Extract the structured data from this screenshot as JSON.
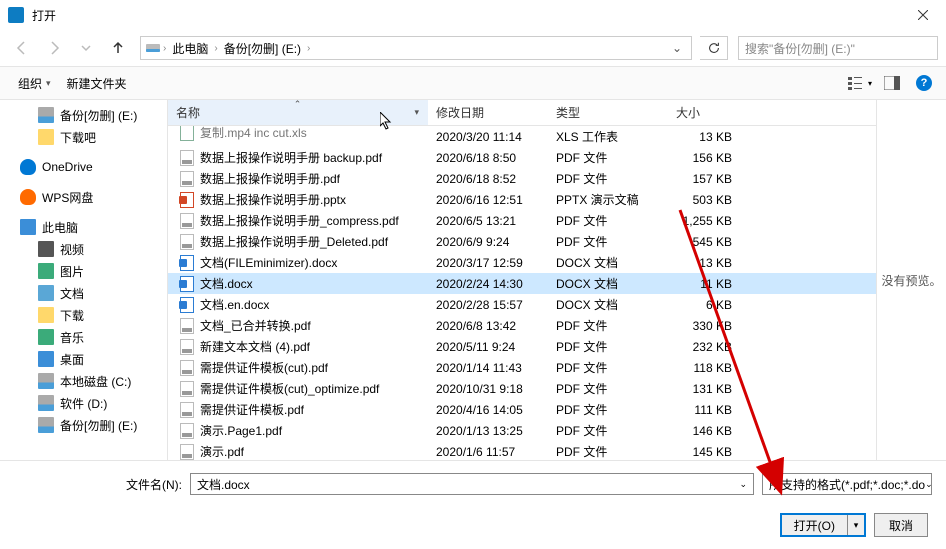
{
  "title": "打开",
  "breadcrumb": {
    "pc": "此电脑",
    "drive": "备份[勿删] (E:)"
  },
  "search_placeholder": "搜索\"备份[勿删] (E:)\"",
  "toolbar": {
    "organize": "组织",
    "newfolder": "新建文件夹"
  },
  "sidebar": [
    {
      "label": "备份[勿删] (E:)",
      "type": "drive",
      "indent": true
    },
    {
      "label": "下载吧",
      "type": "folder-dl",
      "indent": true
    },
    {
      "sep": true
    },
    {
      "label": "OneDrive",
      "type": "onedrive"
    },
    {
      "sep": true
    },
    {
      "label": "WPS网盘",
      "type": "wps"
    },
    {
      "sep": true
    },
    {
      "label": "此电脑",
      "type": "pc"
    },
    {
      "label": "视频",
      "type": "video",
      "indent": true
    },
    {
      "label": "图片",
      "type": "pictures",
      "indent": true
    },
    {
      "label": "文档",
      "type": "docs",
      "indent": true
    },
    {
      "label": "下载",
      "type": "folder-dl",
      "indent": true
    },
    {
      "label": "音乐",
      "type": "music",
      "indent": true
    },
    {
      "label": "桌面",
      "type": "desktop",
      "indent": true
    },
    {
      "label": "本地磁盘 (C:)",
      "type": "drive",
      "indent": true
    },
    {
      "label": "软件 (D:)",
      "type": "drive",
      "indent": true
    },
    {
      "label": "备份[勿删] (E:)",
      "type": "drive",
      "indent": true
    }
  ],
  "columns": {
    "name": "名称",
    "date": "修改日期",
    "type": "类型",
    "size": "大小"
  },
  "files": [
    {
      "name": "复制.mp4 inc cut.xls",
      "date": "2020/3/20 11:14",
      "type": "XLS 工作表",
      "size": "13 KB",
      "icon": "xls",
      "cut": true
    },
    {
      "name": "数据上报操作说明手册 backup.pdf",
      "date": "2020/6/18 8:50",
      "type": "PDF 文件",
      "size": "156 KB",
      "icon": "pdf"
    },
    {
      "name": "数据上报操作说明手册.pdf",
      "date": "2020/6/18 8:52",
      "type": "PDF 文件",
      "size": "157 KB",
      "icon": "pdf"
    },
    {
      "name": "数据上报操作说明手册.pptx",
      "date": "2020/6/16 12:51",
      "type": "PPTX 演示文稿",
      "size": "503 KB",
      "icon": "pptx"
    },
    {
      "name": "数据上报操作说明手册_compress.pdf",
      "date": "2020/6/5 13:21",
      "type": "PDF 文件",
      "size": "1,255 KB",
      "icon": "pdf"
    },
    {
      "name": "数据上报操作说明手册_Deleted.pdf",
      "date": "2020/6/9 9:24",
      "type": "PDF 文件",
      "size": "545 KB",
      "icon": "pdf"
    },
    {
      "name": "文档(FILEminimizer).docx",
      "date": "2020/3/17 12:59",
      "type": "DOCX 文档",
      "size": "13 KB",
      "icon": "docx"
    },
    {
      "name": "文档.docx",
      "date": "2020/2/24 14:30",
      "type": "DOCX 文档",
      "size": "11 KB",
      "icon": "docx",
      "selected": true
    },
    {
      "name": "文档.en.docx",
      "date": "2020/2/28 15:57",
      "type": "DOCX 文档",
      "size": "6 KB",
      "icon": "docx"
    },
    {
      "name": "文档_已合并转换.pdf",
      "date": "2020/6/8 13:42",
      "type": "PDF 文件",
      "size": "330 KB",
      "icon": "pdf"
    },
    {
      "name": "新建文本文档 (4).pdf",
      "date": "2020/5/11 9:24",
      "type": "PDF 文件",
      "size": "232 KB",
      "icon": "pdf"
    },
    {
      "name": "需提供证件模板(cut).pdf",
      "date": "2020/1/14 11:43",
      "type": "PDF 文件",
      "size": "118 KB",
      "icon": "pdf"
    },
    {
      "name": "需提供证件模板(cut)_optimize.pdf",
      "date": "2020/10/31 9:18",
      "type": "PDF 文件",
      "size": "131 KB",
      "icon": "pdf"
    },
    {
      "name": "需提供证件模板.pdf",
      "date": "2020/4/16 14:05",
      "type": "PDF 文件",
      "size": "111 KB",
      "icon": "pdf"
    },
    {
      "name": "演示.Page1.pdf",
      "date": "2020/1/13 13:25",
      "type": "PDF 文件",
      "size": "146 KB",
      "icon": "pdf"
    },
    {
      "name": "演示.pdf",
      "date": "2020/1/6 11:57",
      "type": "PDF 文件",
      "size": "145 KB",
      "icon": "pdf"
    }
  ],
  "preview_text": "没有预览。",
  "filename_label": "文件名(N):",
  "filename_value": "文档.docx",
  "filter_label": "所支持的格式(*.pdf;*.doc;*.do",
  "open_btn": "打开(O)",
  "cancel_btn": "取消"
}
